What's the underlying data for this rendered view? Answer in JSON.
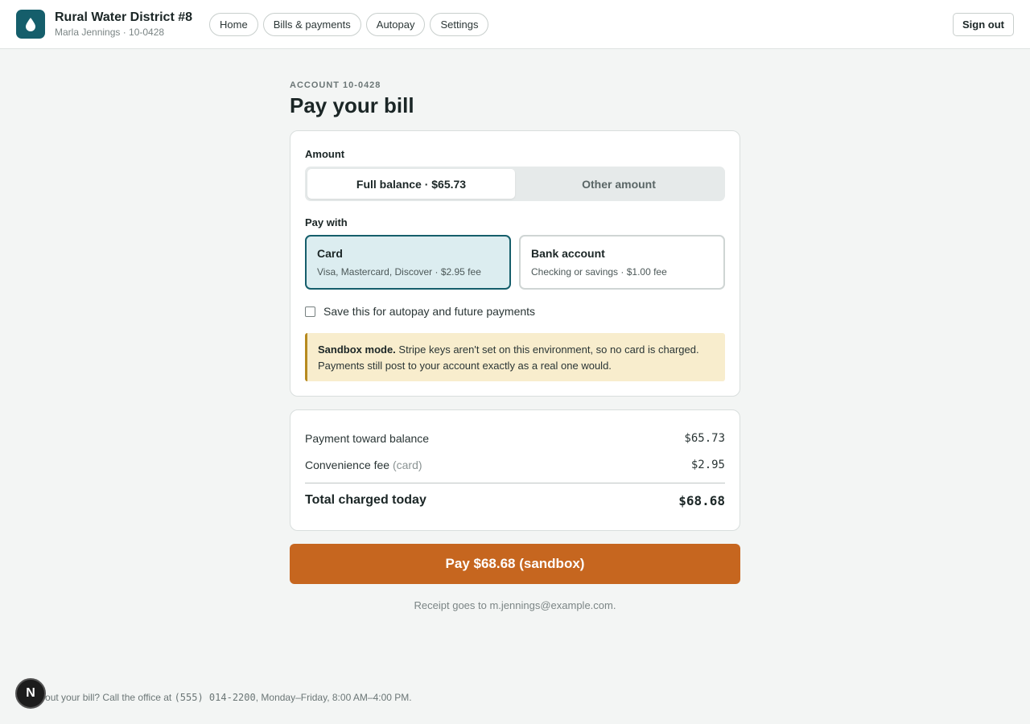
{
  "header": {
    "org_name": "Rural Water District #8",
    "user_line": "Marla Jennings · 10-0428",
    "nav": [
      {
        "label": "Home"
      },
      {
        "label": "Bills & payments"
      },
      {
        "label": "Autopay"
      },
      {
        "label": "Settings"
      }
    ],
    "sign_out": "Sign out",
    "logo_icon": "water-drop-icon",
    "brand_color": "#155e6b"
  },
  "page": {
    "eyebrow": "ACCOUNT 10-0428",
    "title": "Pay your bill"
  },
  "amount": {
    "label": "Amount",
    "options": [
      {
        "label": "Full balance · $65.73",
        "selected": true
      },
      {
        "label": "Other amount",
        "selected": false
      }
    ]
  },
  "pay_with": {
    "label": "Pay with",
    "methods": [
      {
        "title": "Card",
        "subtitle": "Visa, Mastercard, Discover · $2.95 fee",
        "selected": true
      },
      {
        "title": "Bank account",
        "subtitle": "Checking or savings · $1.00 fee",
        "selected": false
      }
    ]
  },
  "save_option": {
    "label": "Save this for autopay and future payments",
    "checked": false
  },
  "notice": {
    "title": "Sandbox mode.",
    "body": " Stripe keys aren't set on this environment, so no card is charged. Payments still post to your account exactly as a real one would."
  },
  "summary": {
    "payment_label": "Payment toward balance",
    "payment_value": "$65.73",
    "fee_label": "Convenience fee",
    "fee_note": "(card)",
    "fee_value": "$2.95",
    "total_label": "Total charged today",
    "total_value": "$68.68"
  },
  "pay_button": "Pay $68.68 (sandbox)",
  "accent_color": "#c6661f",
  "receipt": "Receipt goes to m.jennings@example.com.",
  "footer": {
    "text_start": "ons about your bill? Call the office at ",
    "phone": "(555) 014-2200",
    "text_end": ", Monday–Friday, 8:00 AM–4:00 PM."
  },
  "badge": "N"
}
